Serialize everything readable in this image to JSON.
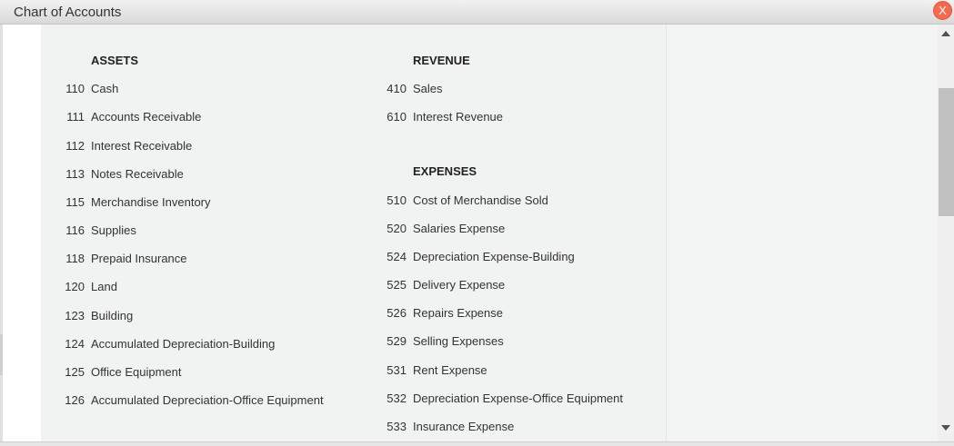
{
  "window": {
    "title": "Chart of Accounts",
    "close_label": "X"
  },
  "assets": {
    "heading": "ASSETS",
    "accounts": [
      {
        "number": "110",
        "name": "Cash"
      },
      {
        "number": "111",
        "name": "Accounts Receivable"
      },
      {
        "number": "112",
        "name": "Interest Receivable"
      },
      {
        "number": "113",
        "name": "Notes Receivable"
      },
      {
        "number": "115",
        "name": "Merchandise Inventory"
      },
      {
        "number": "116",
        "name": "Supplies"
      },
      {
        "number": "118",
        "name": "Prepaid Insurance"
      },
      {
        "number": "120",
        "name": "Land"
      },
      {
        "number": "123",
        "name": "Building"
      },
      {
        "number": "124",
        "name": "Accumulated Depreciation-Building"
      },
      {
        "number": "125",
        "name": "Office Equipment"
      },
      {
        "number": "126",
        "name": "Accumulated Depreciation-Office Equipment"
      }
    ]
  },
  "revenue": {
    "heading": "REVENUE",
    "accounts": [
      {
        "number": "410",
        "name": "Sales"
      },
      {
        "number": "610",
        "name": "Interest Revenue"
      }
    ]
  },
  "expenses": {
    "heading": "EXPENSES",
    "accounts": [
      {
        "number": "510",
        "name": "Cost of Merchandise Sold"
      },
      {
        "number": "520",
        "name": "Salaries Expense"
      },
      {
        "number": "524",
        "name": "Depreciation Expense-Building"
      },
      {
        "number": "525",
        "name": "Delivery Expense"
      },
      {
        "number": "526",
        "name": "Repairs Expense"
      },
      {
        "number": "529",
        "name": "Selling Expenses"
      },
      {
        "number": "531",
        "name": "Rent Expense"
      },
      {
        "number": "532",
        "name": "Depreciation Expense-Office Equipment"
      },
      {
        "number": "533",
        "name": "Insurance Expense"
      }
    ]
  }
}
